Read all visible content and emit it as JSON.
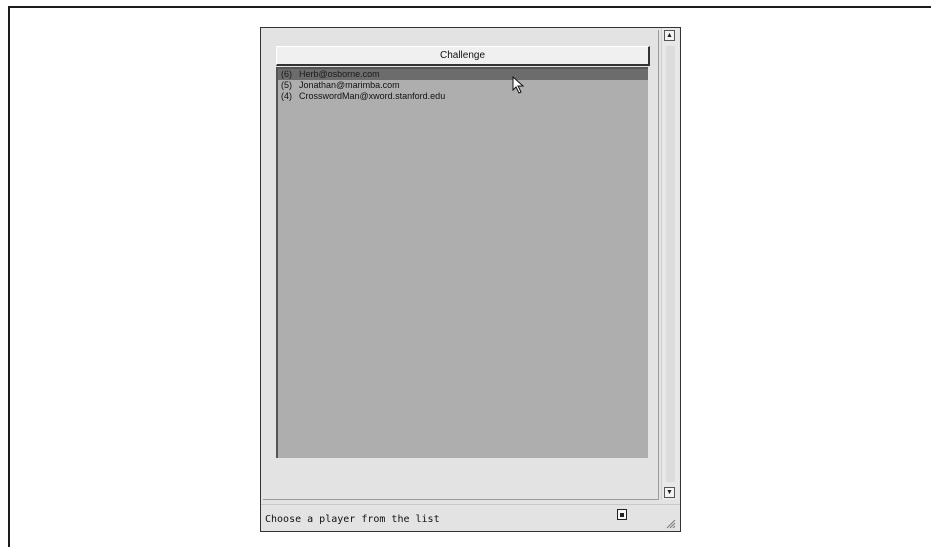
{
  "app": {
    "challenge_button_label": "Challenge",
    "status_text": "Choose a player from the list"
  },
  "players": [
    {
      "rank": "(6)",
      "name": "Herb@osborne.com",
      "selected": true
    },
    {
      "rank": "(5)",
      "name": "Jonathan@marimba.com",
      "selected": false
    },
    {
      "rank": "(4)",
      "name": "CrosswordMan@xword.stanford.edu",
      "selected": false
    }
  ],
  "icons": {
    "cursor": "mouse-pointer-icon",
    "status_doc": "document-icon",
    "resize": "resize-grip-icon",
    "scroll_up": "scroll-up-arrow-icon",
    "scroll_down": "scroll-down-arrow-icon"
  }
}
